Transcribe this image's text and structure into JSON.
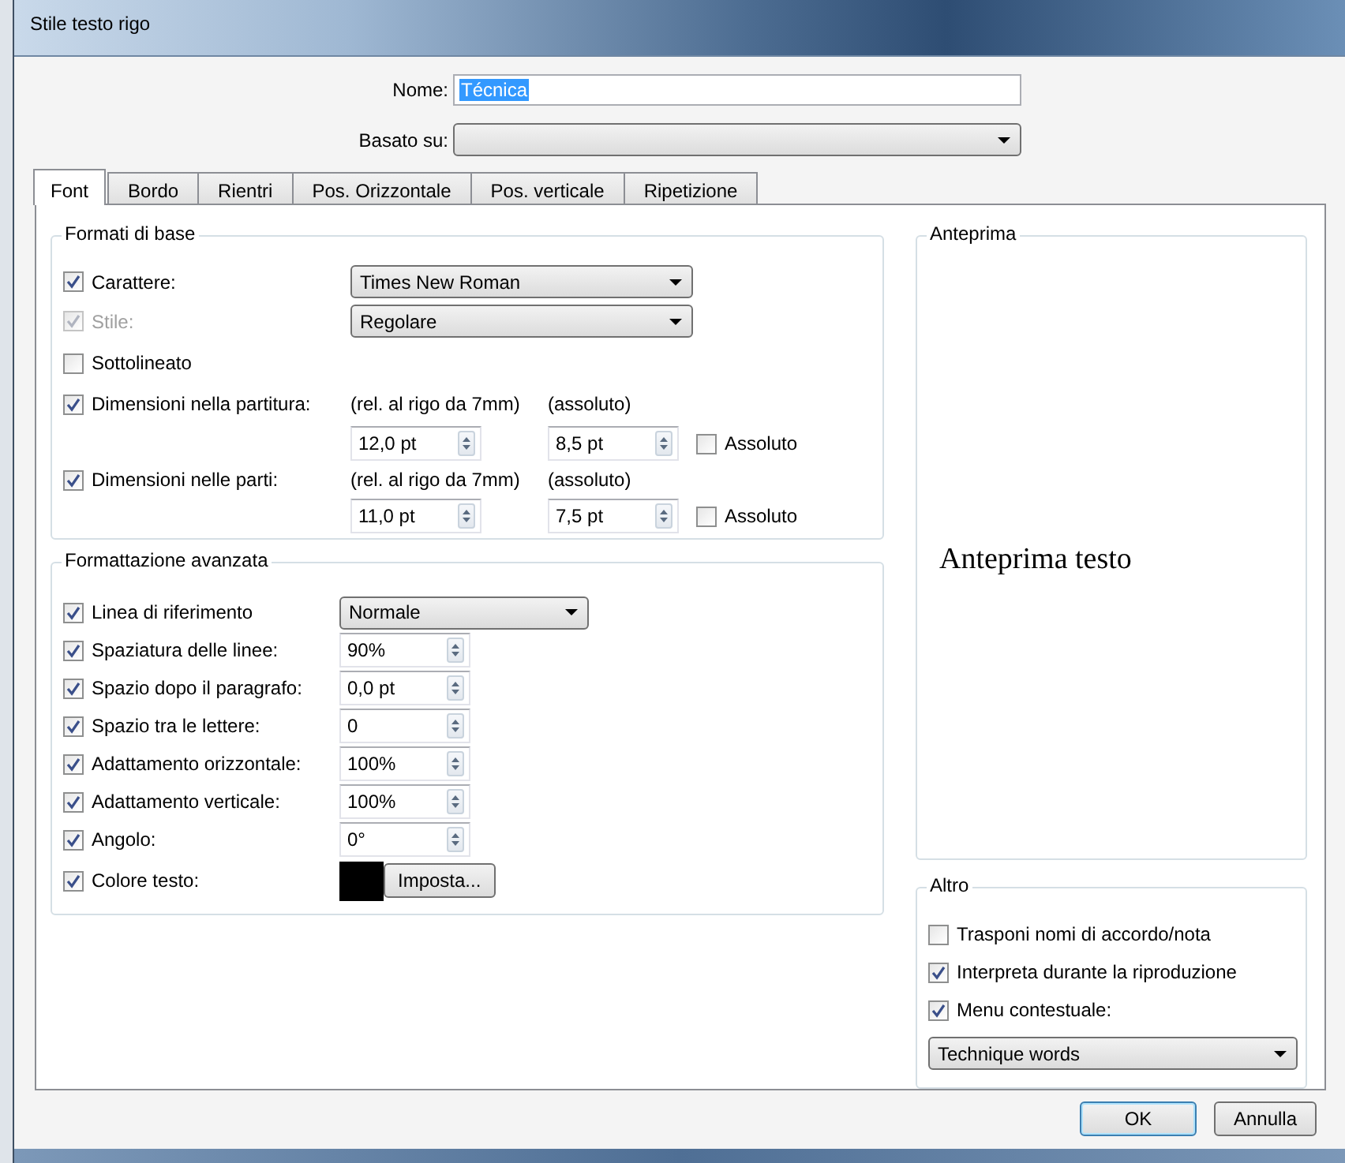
{
  "window": {
    "title": "Stile testo rigo"
  },
  "name_field": {
    "label": "Nome:",
    "value": "Técnica",
    "selected": true
  },
  "based_on": {
    "label": "Basato su:"
  },
  "tabs": [
    {
      "label": "Font",
      "selected": true
    },
    {
      "label": "Bordo",
      "selected": false
    },
    {
      "label": "Rientri",
      "selected": false
    },
    {
      "label": "Pos. Orizzontale",
      "selected": false
    },
    {
      "label": "Pos. verticale",
      "selected": false
    },
    {
      "label": "Ripetizione",
      "selected": false
    }
  ],
  "basic": {
    "title": "Formati di base",
    "rows": [
      {
        "kind": "select",
        "label": "Carattere:",
        "checked": true,
        "disabled": false,
        "value": "Times New Roman"
      },
      {
        "kind": "select",
        "label": "Stile:",
        "checked": true,
        "disabled": true,
        "value": "Regolare"
      },
      {
        "kind": "check",
        "label": "Sottolineato",
        "checked": false,
        "disabled": false
      },
      {
        "kind": "size",
        "label": "Dimensioni nella partitura:",
        "checked": true,
        "disabled": false,
        "relative_label": "(rel. al rigo da 7mm)",
        "absolute_label": "(assoluto)",
        "relative_value": "12,0 pt",
        "absolute_value": "8,5 pt",
        "absolute_check": {
          "label": "Assoluto",
          "checked": false
        }
      },
      {
        "kind": "size",
        "label": "Dimensioni nelle parti:",
        "checked": true,
        "disabled": false,
        "relative_label": "(rel. al rigo da 7mm)",
        "absolute_label": "(assoluto)",
        "relative_value": "11,0 pt",
        "absolute_value": "7,5 pt",
        "absolute_check": {
          "label": "Assoluto",
          "checked": false
        }
      }
    ]
  },
  "advanced": {
    "title": "Formattazione avanzata",
    "rows": [
      {
        "kind": "select",
        "label": "Linea di riferimento",
        "checked": true,
        "value": "Normale"
      },
      {
        "kind": "spin",
        "label": "Spaziatura delle linee:",
        "checked": true,
        "value": "90%"
      },
      {
        "kind": "spin",
        "label": "Spazio dopo il paragrafo:",
        "checked": true,
        "value": "0,0 pt"
      },
      {
        "kind": "spin",
        "label": "Spazio tra le lettere:",
        "checked": true,
        "value": "0"
      },
      {
        "kind": "spin",
        "label": "Adattamento orizzontale:",
        "checked": true,
        "value": "100%"
      },
      {
        "kind": "spin",
        "label": "Adattamento verticale:",
        "checked": true,
        "value": "100%"
      },
      {
        "kind": "spin",
        "label": "Angolo:",
        "checked": true,
        "value": "0°"
      },
      {
        "kind": "color",
        "label": "Colore testo:",
        "checked": true,
        "color": "#000000",
        "button": "Imposta..."
      }
    ]
  },
  "preview": {
    "title": "Anteprima",
    "text": "Anteprima testo"
  },
  "other": {
    "title": "Altro",
    "options": [
      {
        "label": "Trasponi nomi di accordo/nota",
        "checked": false
      },
      {
        "label": "Interpreta durante la riproduzione",
        "checked": true
      },
      {
        "label": "Menu contestuale:",
        "checked": true
      }
    ],
    "dropdown": "Technique words"
  },
  "buttons": [
    {
      "label": "OK",
      "default": true
    },
    {
      "label": "Annulla",
      "default": false
    }
  ]
}
